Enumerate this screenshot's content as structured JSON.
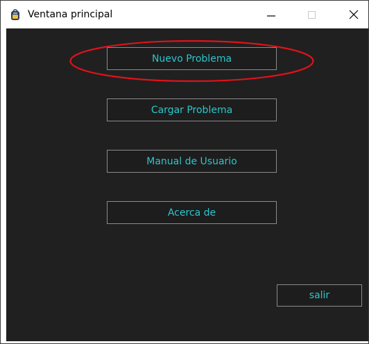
{
  "window": {
    "title": "Ventana principal",
    "app_icon": "backpack-icon",
    "controls": {
      "minimize_icon": "minimize-icon",
      "maximize_icon": "maximize-icon",
      "close_icon": "close-icon"
    }
  },
  "menu": {
    "nuevo_problema": "Nuevo Problema",
    "cargar_problema": "Cargar Problema",
    "manual_usuario": "Manual de Usuario",
    "acerca_de": "Acerca de",
    "salir": "salir"
  },
  "annotation": {
    "highlight_color": "#e0121b",
    "target": "Nuevo Problema"
  },
  "colors": {
    "background": "#202020",
    "button_text": "#2cc6cc",
    "button_border": "#8c8c8c"
  }
}
